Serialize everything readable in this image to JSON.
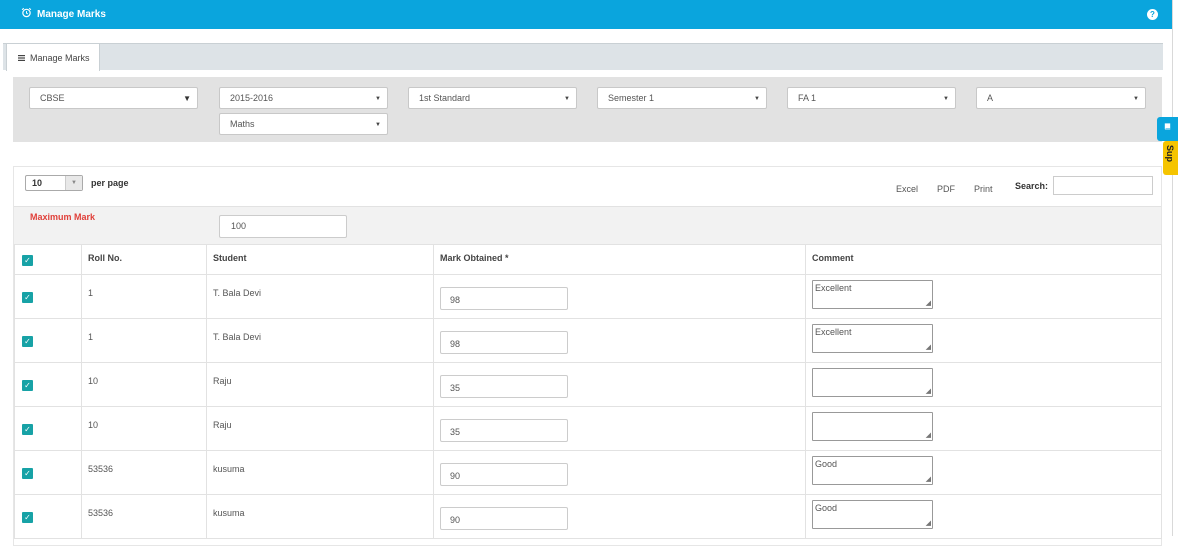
{
  "header": {
    "title": "Manage Marks",
    "help_glyph": "?"
  },
  "tab": {
    "label": "Manage Marks"
  },
  "filters": {
    "board": "CBSE",
    "year": "2015-2016",
    "standard": "1st Standard",
    "semester": "Semester 1",
    "assessment": "FA 1",
    "section": "A",
    "subject": "Maths"
  },
  "pagination": {
    "per_page_value": "10",
    "per_page_label": "per page"
  },
  "toolbar": {
    "excel": "Excel",
    "pdf": "PDF",
    "print": "Print",
    "search_label": "Search:"
  },
  "max_mark": {
    "label": "Maximum Mark",
    "value": "100"
  },
  "table": {
    "headers": {
      "roll": "Roll No.",
      "student": "Student",
      "mark": "Mark Obtained *",
      "comment": "Comment"
    },
    "rows": [
      {
        "roll": "1",
        "student": "T. Bala Devi",
        "mark": "98",
        "comment": "Excellent"
      },
      {
        "roll": "1",
        "student": "T. Bala Devi",
        "mark": "98",
        "comment": "Excellent"
      },
      {
        "roll": "10",
        "student": "Raju",
        "mark": "35",
        "comment": ""
      },
      {
        "roll": "10",
        "student": "Raju",
        "mark": "35",
        "comment": ""
      },
      {
        "roll": "53536",
        "student": "kusuma",
        "mark": "90",
        "comment": "Good"
      },
      {
        "roll": "53536",
        "student": "kusuma",
        "mark": "90",
        "comment": "Good"
      }
    ]
  },
  "side_widget": {
    "label": "Sup"
  },
  "colors": {
    "topbar": "#0aa5dd",
    "checkbox": "#17a2a6",
    "max_mark_label": "#e0403a",
    "side_widget": "#f5c400"
  }
}
